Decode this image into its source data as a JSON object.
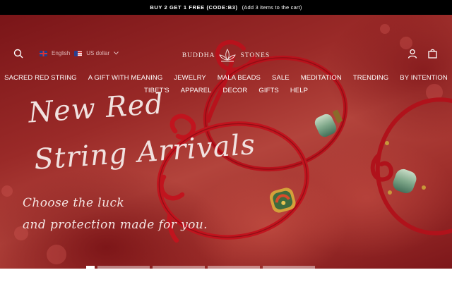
{
  "announcement": {
    "offer": "BUY 2 GET 1 FREE (CODE:B3)",
    "note": "(Add 3 items to the cart)"
  },
  "header": {
    "language": "English",
    "currency": "US dollar",
    "logo_left": "BUDDHA",
    "logo_right": "STONES",
    "icons": [
      "search-icon",
      "account-icon",
      "cart-icon",
      "lotus-logo-icon"
    ]
  },
  "nav": {
    "row1": [
      "SACRED RED STRING",
      "A GIFT WITH MEANING",
      "JEWELRY",
      "MALA BEADS",
      "SALE",
      "MEDITATION",
      "TRENDING",
      "BY INTENTION"
    ],
    "row2": [
      "TIBET'S",
      "APPAREL",
      "DECOR",
      "GIFTS",
      "HELP"
    ]
  },
  "hero": {
    "headline_line1": "New Red",
    "headline_line2": "String Arrivals",
    "sub_line1": "Choose the luck",
    "sub_line2": "and protection made for you."
  },
  "slides": {
    "count": 6,
    "active": 1
  },
  "colors": {
    "announcement_bg": "#000000",
    "hero_red": "#9a2a28",
    "string_red": "#b8121c",
    "jade": "#7fa88a"
  }
}
